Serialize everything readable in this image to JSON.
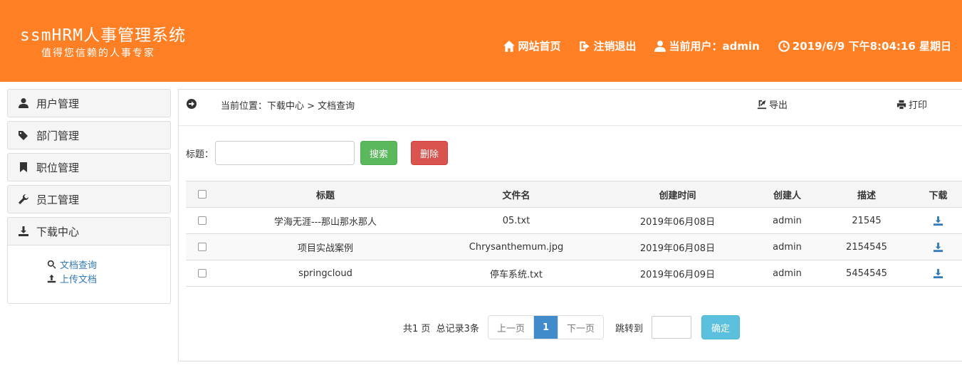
{
  "header": {
    "title": "ssmHRM人事管理系统",
    "subtitle": "值得您信赖的人事专家",
    "nav": {
      "home": "网站首页",
      "logout": "注销退出",
      "user": "当前用户：admin",
      "datetime": "2019/6/9 下午8:04:16 星期日"
    },
    "icons": [
      "home-icon",
      "logout-icon",
      "user-icon",
      "clock-icon"
    ],
    "bg_color": "#ff7f24"
  },
  "sidebar": {
    "items": [
      {
        "label": "用户管理",
        "icon": "user-icon"
      },
      {
        "label": "部门管理",
        "icon": "tags-icon"
      },
      {
        "label": "职位管理",
        "icon": "bookmark-icon"
      },
      {
        "label": "员工管理",
        "icon": "wrench-icon"
      },
      {
        "label": "下载中心",
        "icon": "download-icon"
      }
    ],
    "sub": [
      {
        "label": "文档查询",
        "icon": "search-icon"
      },
      {
        "label": "上传文档",
        "icon": "upload-icon"
      }
    ]
  },
  "main": {
    "breadcrumb": "当前位置：下载中心 > 文档查询",
    "export_label": "导出",
    "print_label": "打印",
    "search": {
      "label": "标题：",
      "value": "",
      "button": "搜索",
      "delete_button": "删除"
    },
    "table": {
      "headers": [
        "标题",
        "文件名",
        "创建时间",
        "创建人",
        "描述",
        "下载"
      ],
      "rows": [
        [
          "学海无涯---那山那水那人",
          "05.txt",
          "2019年06月08日",
          "admin",
          "21545"
        ],
        [
          "项目实战案例",
          "Chrysanthemum.jpg",
          "2019年06月08日",
          "admin",
          "2154545"
        ],
        [
          "springcloud",
          "停车系统.txt",
          "2019年06月09日",
          "admin",
          "5454545"
        ]
      ]
    },
    "pager": {
      "info": "共1 页  总记录3条",
      "prev": "上一页",
      "current": "1",
      "next": "下一页",
      "jump_label": "跳转到",
      "jump_value": "",
      "confirm": "确定"
    }
  }
}
